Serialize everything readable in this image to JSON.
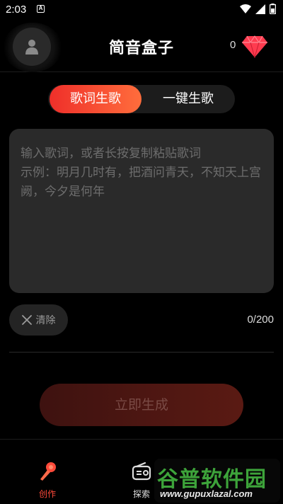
{
  "status_bar": {
    "time": "2:03",
    "notification_glyph": "A",
    "icons": [
      "wifi-icon",
      "signal-icon",
      "battery-icon"
    ]
  },
  "header": {
    "title": "简音盒子",
    "gem_count": "0",
    "avatar_icon": "person-icon",
    "gem_icon": "diamond-icon",
    "gem_color": "#ff3b4f"
  },
  "tabs": [
    {
      "label": "歌词生歌",
      "active": true
    },
    {
      "label": "一键生歌",
      "active": false
    }
  ],
  "lyric_input": {
    "placeholder": "输入歌词，或者长按复制粘贴歌词\n示例：明月几时有，把酒问青天，不知天上宫阙，今夕是何年",
    "value": ""
  },
  "clear_button": {
    "label": "清除",
    "icon": "close-icon"
  },
  "char_count": "0/200",
  "generate_button": {
    "label": "立即生成"
  },
  "bottom_nav": [
    {
      "label": "创作",
      "icon": "microphone-icon",
      "active": true
    },
    {
      "label": "探索",
      "icon": "radio-icon",
      "active": false
    }
  ],
  "watermark": {
    "main": "谷普软件园",
    "url": "www.gupuxlazal.com"
  },
  "colors": {
    "accent_start": "#ef2f2a",
    "accent_end": "#ff6d3c",
    "background": "#000000",
    "panel": "#2a2a2a"
  }
}
